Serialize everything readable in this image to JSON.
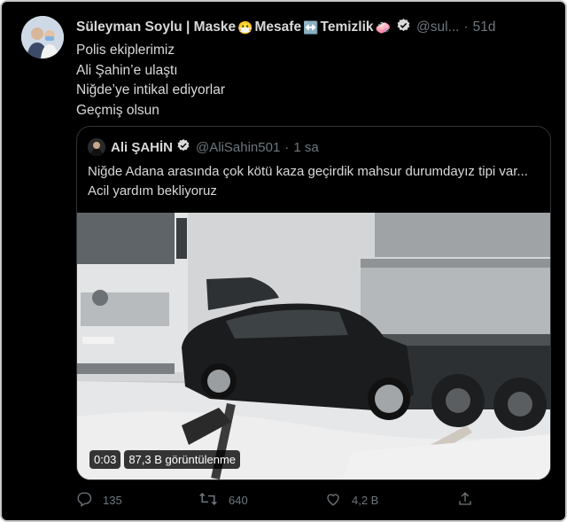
{
  "tweet": {
    "author_name": "Süleyman Soylu | Maske",
    "emoji_mask": "😷",
    "name_part2": " Mesafe",
    "emoji_arrow": "↔️",
    "name_part3": " Temizlik",
    "emoji_soap": "🧼",
    "handle": "@sul...",
    "separator": "·",
    "time": "51d",
    "lines": [
      "Polis ekiplerimiz",
      "Ali Şahin’e ulaştı",
      "Niğde’ye intikal ediyorlar",
      "Geçmiş olsun"
    ]
  },
  "quoted": {
    "author_name": "Ali ŞAHİN",
    "handle": "@AliSahin501",
    "separator": "·",
    "time": "1 sa",
    "text": "Niğde Adana arasında çok kötü kaza geçirdik mahsur durumdayız tipi var... Acil yardım bekliyoruz",
    "video": {
      "duration": "0:03",
      "views": "87,3 B görüntülenme"
    }
  },
  "actions": {
    "reply_count": "135",
    "retweet_count": "640",
    "like_count": "4,2 B",
    "icons": [
      "reply-icon",
      "retweet-icon",
      "like-icon",
      "share-icon"
    ]
  },
  "colors": {
    "background": "#000000",
    "text": "#d9d9d9",
    "muted": "#6e767d",
    "border": "#2f3336"
  }
}
